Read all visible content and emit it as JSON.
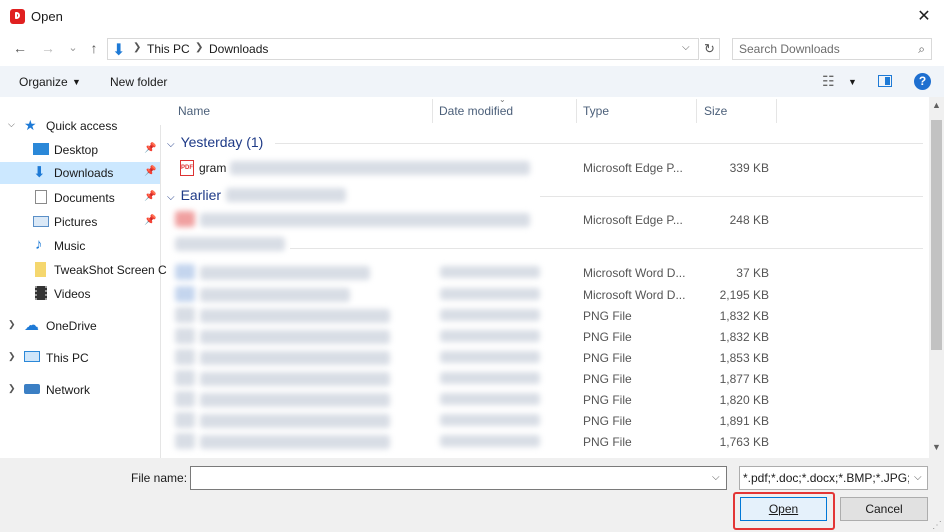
{
  "window": {
    "title": "Open",
    "close_glyph": "✕"
  },
  "address": {
    "back_glyph": "←",
    "forward_glyph": "→",
    "recent_glyph": "⌄",
    "up_glyph": "↑",
    "breadcrumbs": [
      "This PC",
      "Downloads"
    ],
    "refresh_glyph": "↻"
  },
  "search": {
    "placeholder": "Search Downloads"
  },
  "toolbar": {
    "organize_label": "Organize",
    "new_folder_label": "New folder",
    "help_glyph": "?"
  },
  "nav": {
    "quick_access": "Quick access",
    "items": [
      {
        "label": "Desktop",
        "icon": "desktop-icon",
        "pinned": true
      },
      {
        "label": "Downloads",
        "icon": "downloads-icon",
        "pinned": true,
        "selected": true
      },
      {
        "label": "Documents",
        "icon": "documents-icon",
        "pinned": true
      },
      {
        "label": "Pictures",
        "icon": "pictures-icon",
        "pinned": true
      },
      {
        "label": "Music",
        "icon": "music-icon",
        "pinned": false
      },
      {
        "label": "TweakShot Screen C",
        "icon": "folder-icon",
        "pinned": false
      },
      {
        "label": "Videos",
        "icon": "videos-icon",
        "pinned": false
      }
    ],
    "onedrive": "OneDrive",
    "thispc": "This PC",
    "network": "Network"
  },
  "columns": {
    "name": "Name",
    "date": "Date modified",
    "type": "Type",
    "size": "Size"
  },
  "groups": {
    "yesterday": "Yesterday (1)",
    "earlier": "Earlier"
  },
  "files": [
    {
      "name": "gram",
      "type": "Microsoft Edge P...",
      "size": "339 KB"
    },
    {
      "name": "",
      "type": "Microsoft Edge P...",
      "size": "248 KB"
    },
    {
      "name": "",
      "type": "Microsoft Word D...",
      "size": "37 KB"
    },
    {
      "name": "",
      "type": "Microsoft Word D...",
      "size": "2,195 KB"
    },
    {
      "name": "",
      "type": "PNG File",
      "size": "1,832 KB"
    },
    {
      "name": "",
      "type": "PNG File",
      "size": "1,832 KB"
    },
    {
      "name": "",
      "type": "PNG File",
      "size": "1,853 KB"
    },
    {
      "name": "",
      "type": "PNG File",
      "size": "1,877 KB"
    },
    {
      "name": "",
      "type": "PNG File",
      "size": "1,820 KB"
    },
    {
      "name": "",
      "type": "PNG File",
      "size": "1,891 KB"
    },
    {
      "name": "",
      "type": "PNG File",
      "size": "1,763 KB"
    }
  ],
  "bottom": {
    "file_name_label": "File name:",
    "file_name_value": "",
    "file_type": "*.pdf;*.doc;*.docx;*.BMP;*.JPG;",
    "open_label": "Open",
    "cancel_label": "Cancel"
  }
}
